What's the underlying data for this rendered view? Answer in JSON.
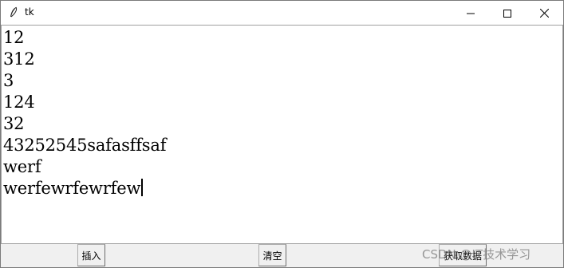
{
  "window": {
    "title": "tk",
    "icon": "tk-feather-icon"
  },
  "controls": {
    "minimize_icon": "minimize-icon",
    "maximize_icon": "maximize-icon",
    "close_icon": "close-icon"
  },
  "text_widget": {
    "lines": [
      "12",
      "312",
      "3",
      "124",
      "32",
      "43252545safasffsaf",
      "werf",
      "werfewrfewrfew"
    ]
  },
  "buttons": {
    "insert_label": "插入",
    "clear_label": "清空",
    "get_label": "获取数据"
  },
  "watermark": {
    "text": "CSDN @IT技术学习"
  }
}
